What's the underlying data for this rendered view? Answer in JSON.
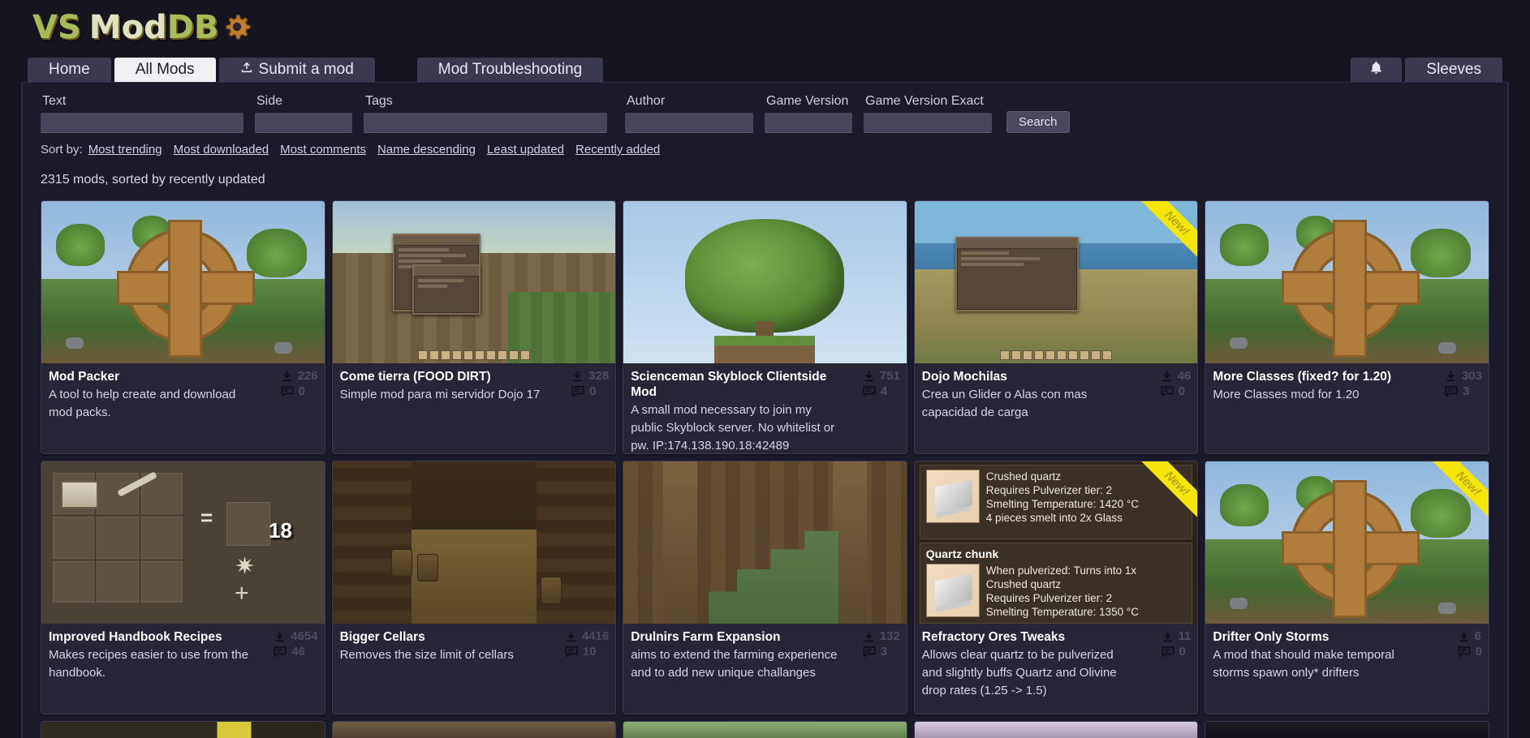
{
  "site": {
    "logo_vs": "VS",
    "logo_mod": "Mod",
    "logo_db": "DB",
    "gear_icon": "gear-icon"
  },
  "tabs": [
    {
      "label": "Home",
      "active": false,
      "icon": null
    },
    {
      "label": "All Mods",
      "active": true,
      "icon": null
    },
    {
      "label": "Submit a mod",
      "active": false,
      "icon": "upload-icon"
    },
    {
      "label": "Mod Troubleshooting",
      "active": false,
      "icon": null
    }
  ],
  "user": {
    "notifications_icon": "bell-icon",
    "name": "Sleeves"
  },
  "search": {
    "fields": [
      {
        "label": "Text",
        "value": "",
        "placeholder": ""
      },
      {
        "label": "Side",
        "value": "",
        "placeholder": ""
      },
      {
        "label": "Tags",
        "value": "",
        "placeholder": ""
      },
      {
        "label": "Author",
        "value": "",
        "placeholder": ""
      },
      {
        "label": "Game Version",
        "value": "",
        "placeholder": ""
      },
      {
        "label": "Game Version Exact",
        "value": "",
        "placeholder": ""
      }
    ],
    "button_label": "Search"
  },
  "sort": {
    "label": "Sort by:",
    "options": [
      "Most trending",
      "Most downloaded",
      "Most comments",
      "Name descending",
      "Least updated",
      "Recently added"
    ]
  },
  "results": {
    "count_text": "2315 mods, sorted by recently updated"
  },
  "icons": {
    "download": "download-icon",
    "comment": "comment-icon"
  },
  "mods": [
    {
      "title": "Mod Packer",
      "description": "A tool to help create and download mod packs.",
      "downloads": "226",
      "comments": "0",
      "new": false,
      "art": "gear"
    },
    {
      "title": "Come tierra (FOOD DIRT)",
      "description": "Simple mod para mi servidor Dojo 17",
      "downloads": "328",
      "comments": "0",
      "new": false,
      "art": "indoor-ui"
    },
    {
      "title": "Scienceman Skyblock Clientside Mod",
      "description": "A small mod necessary to join my public Skyblock server. No whitelist or pw. IP:174.138.190.18:42489",
      "downloads": "751",
      "comments": "4",
      "new": false,
      "art": "tree-sky"
    },
    {
      "title": "Dojo Mochilas",
      "description": "Crea un Glider o Alas con mas capacidad de carga",
      "downloads": "46",
      "comments": "0",
      "new": true,
      "art": "beach"
    },
    {
      "title": "More Classes (fixed? for 1.20)",
      "description": "More Classes mod for 1.20",
      "downloads": "303",
      "comments": "3",
      "new": false,
      "art": "gear"
    },
    {
      "title": "Improved Handbook Recipes",
      "description": "Makes recipes easier to use from the handbook.",
      "downloads": "4654",
      "comments": "46",
      "new": false,
      "art": "craftgrid"
    },
    {
      "title": "Bigger Cellars",
      "description": "Removes the size limit of cellars",
      "downloads": "4416",
      "comments": "10",
      "new": false,
      "art": "cellar"
    },
    {
      "title": "Drulnirs Farm Expansion",
      "description": "aims to extend the farming experience and to add new unique challanges",
      "downloads": "132",
      "comments": "3",
      "new": false,
      "art": "barn"
    },
    {
      "title": "Refractory Ores Tweaks",
      "description": "Allows clear quartz to be pulverized and slightly buffs Quartz and Olivine drop rates (1.25 -> 1.5)",
      "downloads": "11",
      "comments": "0",
      "new": true,
      "art": "tooltip"
    },
    {
      "title": "Drifter Only Storms",
      "description": "A mod that should make temporal storms spawn only* drifters",
      "downloads": "6",
      "comments": "0",
      "new": true,
      "art": "gear"
    }
  ],
  "tooltip_art": {
    "item1": {
      "lines": [
        "Crushed quartz",
        "Requires Pulverizer tier: 2",
        "Smelting Temperature: 1420 °C",
        "4 pieces smelt into 2x Glass"
      ]
    },
    "item2": {
      "title": "Quartz chunk",
      "lines": [
        "When pulverized: Turns into 1x",
        "Crushed quartz",
        "Requires Pulverizer tier: 2",
        "Smelting Temperature: 1350 °C"
      ]
    }
  },
  "ribbon": {
    "label": "New!"
  },
  "colors": {
    "accent_green": "#a8bb5a",
    "panel_bg": "#1b1a28",
    "card_bg": "#272536",
    "ribbon": "#f5e50a",
    "active_tab": "#eef0f4"
  }
}
